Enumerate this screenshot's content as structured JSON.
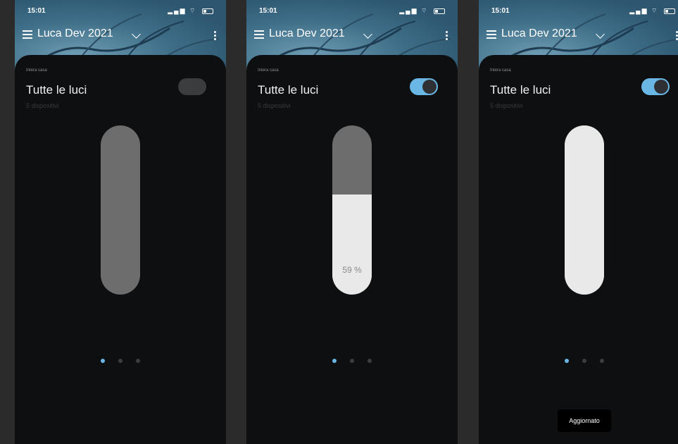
{
  "screens": [
    {
      "status": {
        "time": "15:01"
      },
      "header": {
        "title": "Luca Dev 2021"
      },
      "card": {
        "eyebrow": "Intera casa",
        "title": "Tutte le luci",
        "subtitle": "5 dispositivi",
        "toggle_on": false,
        "slider_level": 0
      },
      "pager": {
        "pages": 3,
        "active": 0
      }
    },
    {
      "status": {
        "time": "15:01"
      },
      "header": {
        "title": "Luca Dev 2021"
      },
      "card": {
        "eyebrow": "Intera casa",
        "title": "Tutte le luci",
        "subtitle": "5 dispositivi",
        "toggle_on": true,
        "slider_level": 0.59,
        "slider_label": "59 %"
      },
      "pager": {
        "pages": 3,
        "active": 0
      }
    },
    {
      "status": {
        "time": "15:01"
      },
      "header": {
        "title": "Luca Dev 2021"
      },
      "card": {
        "eyebrow": "Intera casa",
        "title": "Tutte le luci",
        "subtitle": "5 dispositivi",
        "toggle_on": true,
        "slider_level": 1.0
      },
      "pager": {
        "pages": 3,
        "active": 0
      },
      "toast": "Aggiornato"
    }
  ],
  "colors": {
    "accent": "#6ab7e6",
    "card_bg": "#0e0f10",
    "slider_track": "#6d6d6d",
    "slider_fill": "#e9e9e9"
  },
  "icons": [
    "menu-icon",
    "chevron-down-icon",
    "more-vert-icon",
    "signal-icon",
    "wifi-icon",
    "battery-icon"
  ]
}
